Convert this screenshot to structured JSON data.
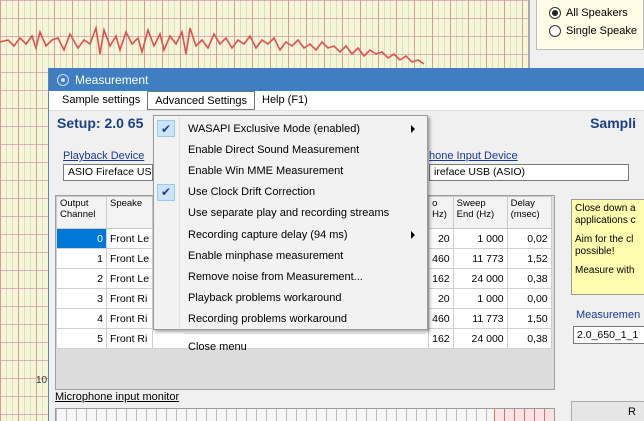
{
  "background": {
    "axis_label": "10",
    "speaker_options": [
      {
        "label": "All Speakers",
        "selected": true
      },
      {
        "label": "Single Speake",
        "selected": false
      }
    ]
  },
  "window": {
    "title": "Measurement",
    "menu": [
      "Sample settings",
      "Advanced Settings",
      "Help (F1)"
    ],
    "setup_title": "Setup: 2.0  65",
    "sampling_title": "Sampli",
    "playback_link": "Playback Device",
    "playback_value": "ASIO Fireface USB",
    "mic_link": "hone Input Device",
    "mic_value": "ireface USB (ASIO)"
  },
  "table": {
    "headers": [
      "Output Channel",
      "Speake",
      "o Hz)",
      "Sweep End (Hz)",
      "Delay (msec)"
    ],
    "rows": [
      {
        "ch": "0",
        "spk": "Front Le",
        "start": "20",
        "end": "1 000",
        "delay": "0,02"
      },
      {
        "ch": "1",
        "spk": "Front Le",
        "start": "460",
        "end": "11 773",
        "delay": "1,52"
      },
      {
        "ch": "2",
        "spk": "Front Le",
        "start": "162",
        "end": "24 000",
        "delay": "0,38"
      },
      {
        "ch": "3",
        "spk": "Front Ri",
        "start": "20",
        "end": "1 000",
        "delay": "0,00"
      },
      {
        "ch": "4",
        "spk": "Front Ri",
        "start": "460",
        "end": "11 773",
        "delay": "1,50"
      },
      {
        "ch": "5",
        "spk": "Front Ri",
        "start": "162",
        "end": "24 000",
        "delay": "0,38"
      }
    ]
  },
  "notes": {
    "lines": [
      "Close down a",
      "applications c",
      "Aim for the cl",
      "possible!",
      "Measure with"
    ],
    "measurement_label": "Measuremen",
    "measurement_name": "2.0_650_1_1"
  },
  "microphone": {
    "label": "Microphone input monitor",
    "button_label": "R"
  },
  "dropdown": {
    "items": [
      {
        "label": "WASAPI Exclusive Mode (enabled)",
        "checked": true,
        "submenu": true
      },
      {
        "label": "Enable Direct Sound Measurement",
        "checked": false,
        "submenu": false
      },
      {
        "label": "Enable Win MME Measurement",
        "checked": false,
        "submenu": false
      },
      {
        "label": "Use Clock Drift Correction",
        "checked": true,
        "submenu": false
      },
      {
        "label": "Use separate play and recording streams",
        "checked": false,
        "submenu": false
      },
      {
        "label": "Recording capture delay (94 ms)",
        "checked": false,
        "submenu": true
      },
      {
        "label": "Enable minphase measurement",
        "checked": false,
        "submenu": false
      },
      {
        "label": "Remove noise from Measurement...",
        "checked": false,
        "submenu": false
      },
      {
        "label": "Playback problems workaround",
        "checked": false,
        "submenu": false
      },
      {
        "label": "Recording problems workaround",
        "checked": false,
        "submenu": false
      }
    ],
    "close_label": "Close menu"
  }
}
